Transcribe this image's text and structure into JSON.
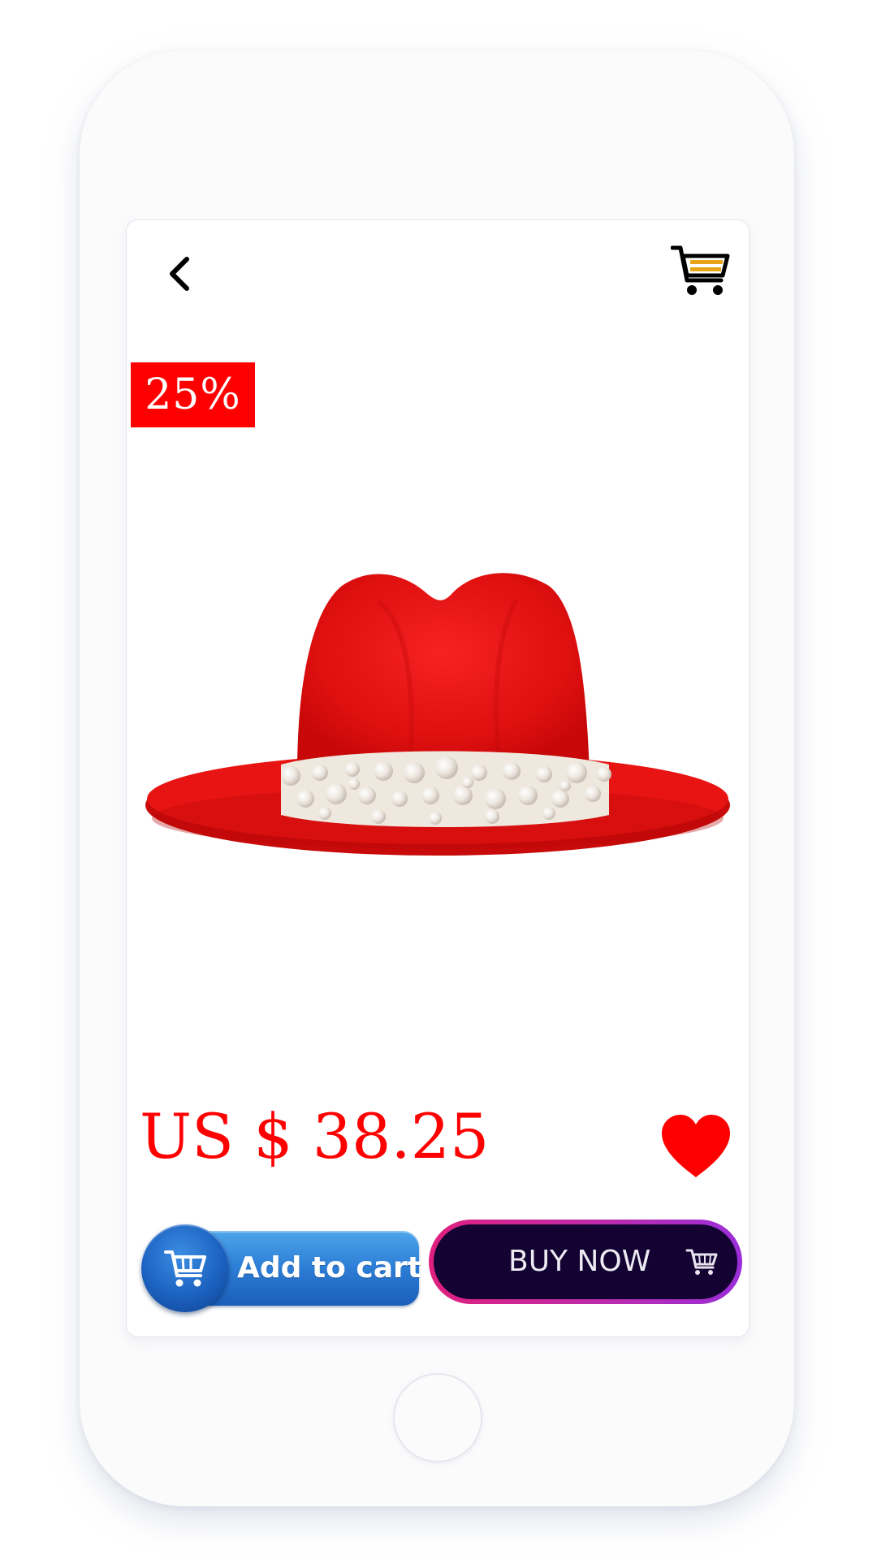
{
  "product": {
    "discount_label": "25%",
    "price": "US $ 38.25",
    "image_alt": "Red fedora hat with pearl band"
  },
  "actions": {
    "add_to_cart_label": "Add to cart",
    "buy_now_label": "BUY NOW"
  },
  "colors": {
    "accent": "#ff0000",
    "add_to_cart_blue": "#1f6ac8",
    "buy_now_bg": "#130232",
    "buy_now_border": "#c02aa6",
    "cart_icon_accent": "#e8a317"
  },
  "icons": {
    "back": "chevron-left-icon",
    "cart": "shopping-cart-icon",
    "wishlist": "heart-icon",
    "add_to_cart": "shopping-cart-icon",
    "buy_now": "shopping-cart-icon"
  }
}
